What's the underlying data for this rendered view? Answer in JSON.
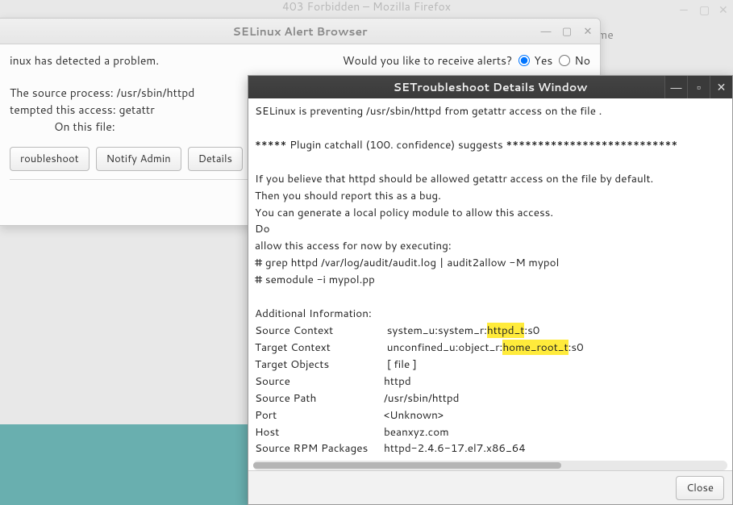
{
  "background": {
    "firefox_title": "403 Forbidden – Mozilla Firefox",
    "breadcrumb": "/home"
  },
  "alert_window": {
    "title": "SELinux Alert Browser",
    "detected": "inux has detected a problem.",
    "receive_alerts": "Would you like to receive alerts?",
    "yes": "Yes",
    "no": "No",
    "source_line": "The source process: /usr/sbin/httpd",
    "attempt_line": "tempted this access:  getattr",
    "on_file_line": "On this file:",
    "buttons": {
      "troubleshoot": "roubleshoot",
      "notify": "Notify Admin",
      "details": "Details"
    }
  },
  "details_window": {
    "title": "SETroubleshoot Details Window",
    "close_button": "Close",
    "lines": {
      "l1": "SELinux is preventing /usr/sbin/httpd from getattr access on the file .",
      "l2": "",
      "l3": "*****  Plugin catchall (100. confidence) suggests   ***************************",
      "l4": "",
      "l5": "If you believe that httpd should be allowed getattr access on the  file by default.",
      "l6": "Then you should report this as a bug.",
      "l7": "You can generate a local policy module to allow this access.",
      "l8": "Do",
      "l9": "allow this access for now by executing:",
      "l10": "# grep httpd /var/log/audit/audit.log | audit2allow -M mypol",
      "l11": "# semodule -i mypol.pp",
      "l12": "",
      "l13": "Additional Information:",
      "src_ctx_label": "Source Context",
      "src_ctx_pre": "system_u:system_r:",
      "src_ctx_hl": "httpd_t",
      "src_ctx_post": ":s0",
      "tgt_ctx_label": "Target Context",
      "tgt_ctx_pre": "unconfined_u:object_r:",
      "tgt_ctx_hl": "home_root_t",
      "tgt_ctx_post": ":s0",
      "tgt_obj_label": "Target Objects",
      "tgt_obj_val": " [ file ]",
      "src_label": "Source",
      "src_val": "httpd",
      "src_path_label": "Source Path",
      "src_path_val": "/usr/sbin/httpd",
      "port_label": "Port",
      "port_val": "<Unknown>",
      "host_label": "Host",
      "host_val": "beanxyz.com",
      "rpm_label": "Source RPM Packages",
      "rpm_val": "httpd-2.4.6-17.el7.x86_64"
    }
  }
}
